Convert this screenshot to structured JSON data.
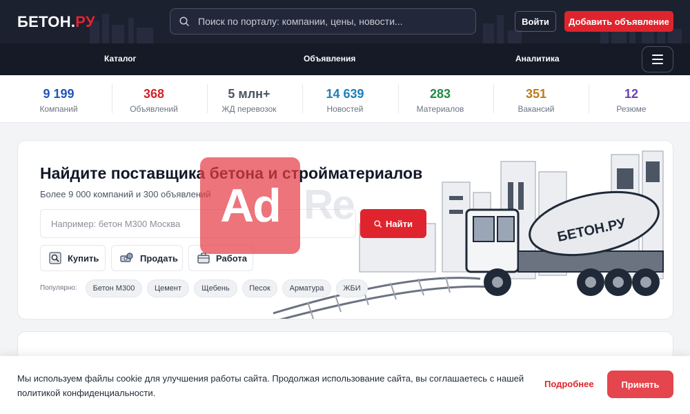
{
  "header": {
    "logo_main": "БЕТОН.",
    "logo_accent": "РУ",
    "search_placeholder": "Поиск по порталу: компании, цены, новости...",
    "login_label": "Войти",
    "add_label": "Добавить объявление",
    "icons": {
      "search": "search-icon",
      "menu": "menu-icon"
    }
  },
  "nav": {
    "items": [
      {
        "label": "Каталог"
      },
      {
        "label": "Объявления"
      },
      {
        "label": "Аналитика"
      }
    ]
  },
  "stats": [
    {
      "value": "9 199",
      "label": "Компаний",
      "color": "#2255b8"
    },
    {
      "value": "368",
      "label": "Объявлений",
      "color": "#d0242b"
    },
    {
      "value": "5 млн+",
      "label": "ЖД перевозок",
      "color": "#4b5563"
    },
    {
      "value": "14 639",
      "label": "Новостей",
      "color": "#1d7fb8"
    },
    {
      "value": "283",
      "label": "Материалов",
      "color": "#1f8a43"
    },
    {
      "value": "351",
      "label": "Вакансий",
      "color": "#c07a16"
    },
    {
      "value": "12",
      "label": "Резюме",
      "color": "#6b3fb8"
    }
  ],
  "hero": {
    "title": "Найдите поставщика бетона и стройматериалов",
    "subtitle": "Более 9 000 компаний и 300 объявлений",
    "input_placeholder": "Например: бетон М300 Москва",
    "find_label": "Найти",
    "actions": [
      {
        "label": "Купить",
        "icon": "magnifier-doc-icon"
      },
      {
        "label": "Продать",
        "icon": "money-icon"
      },
      {
        "label": "Работа",
        "icon": "briefcase-icon"
      }
    ],
    "popular_label": "Популярно:",
    "popular": [
      "Бетон М300",
      "Цемент",
      "Щебень",
      "Песок",
      "Арматура",
      "ЖБИ"
    ],
    "truck_label": "БЕТОН.РУ"
  },
  "watermark": {
    "text": "Ad",
    "ghost": "Re"
  },
  "cookie": {
    "text": "Мы используем файлы cookie для улучшения работы сайта. Продолжая использование сайта, вы соглашаетесь с нашей политикой конфиденциальности.",
    "more_label": "Подробнее",
    "accept_label": "Принять"
  },
  "colors": {
    "header_bg": "#1c2130",
    "nav_bg": "#151a26",
    "accent": "#e0242d"
  }
}
